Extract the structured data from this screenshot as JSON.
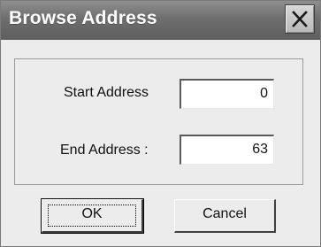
{
  "window": {
    "title": "Browse Address",
    "close_icon": "close-icon"
  },
  "form": {
    "start_label": "Start Address",
    "start_value": "0",
    "end_label": "End Address :",
    "end_value": "63"
  },
  "buttons": {
    "ok_label": "OK",
    "cancel_label": "Cancel"
  },
  "colors": {
    "titlebar": "#6e6e6e",
    "dialog_bg": "#ececec"
  }
}
